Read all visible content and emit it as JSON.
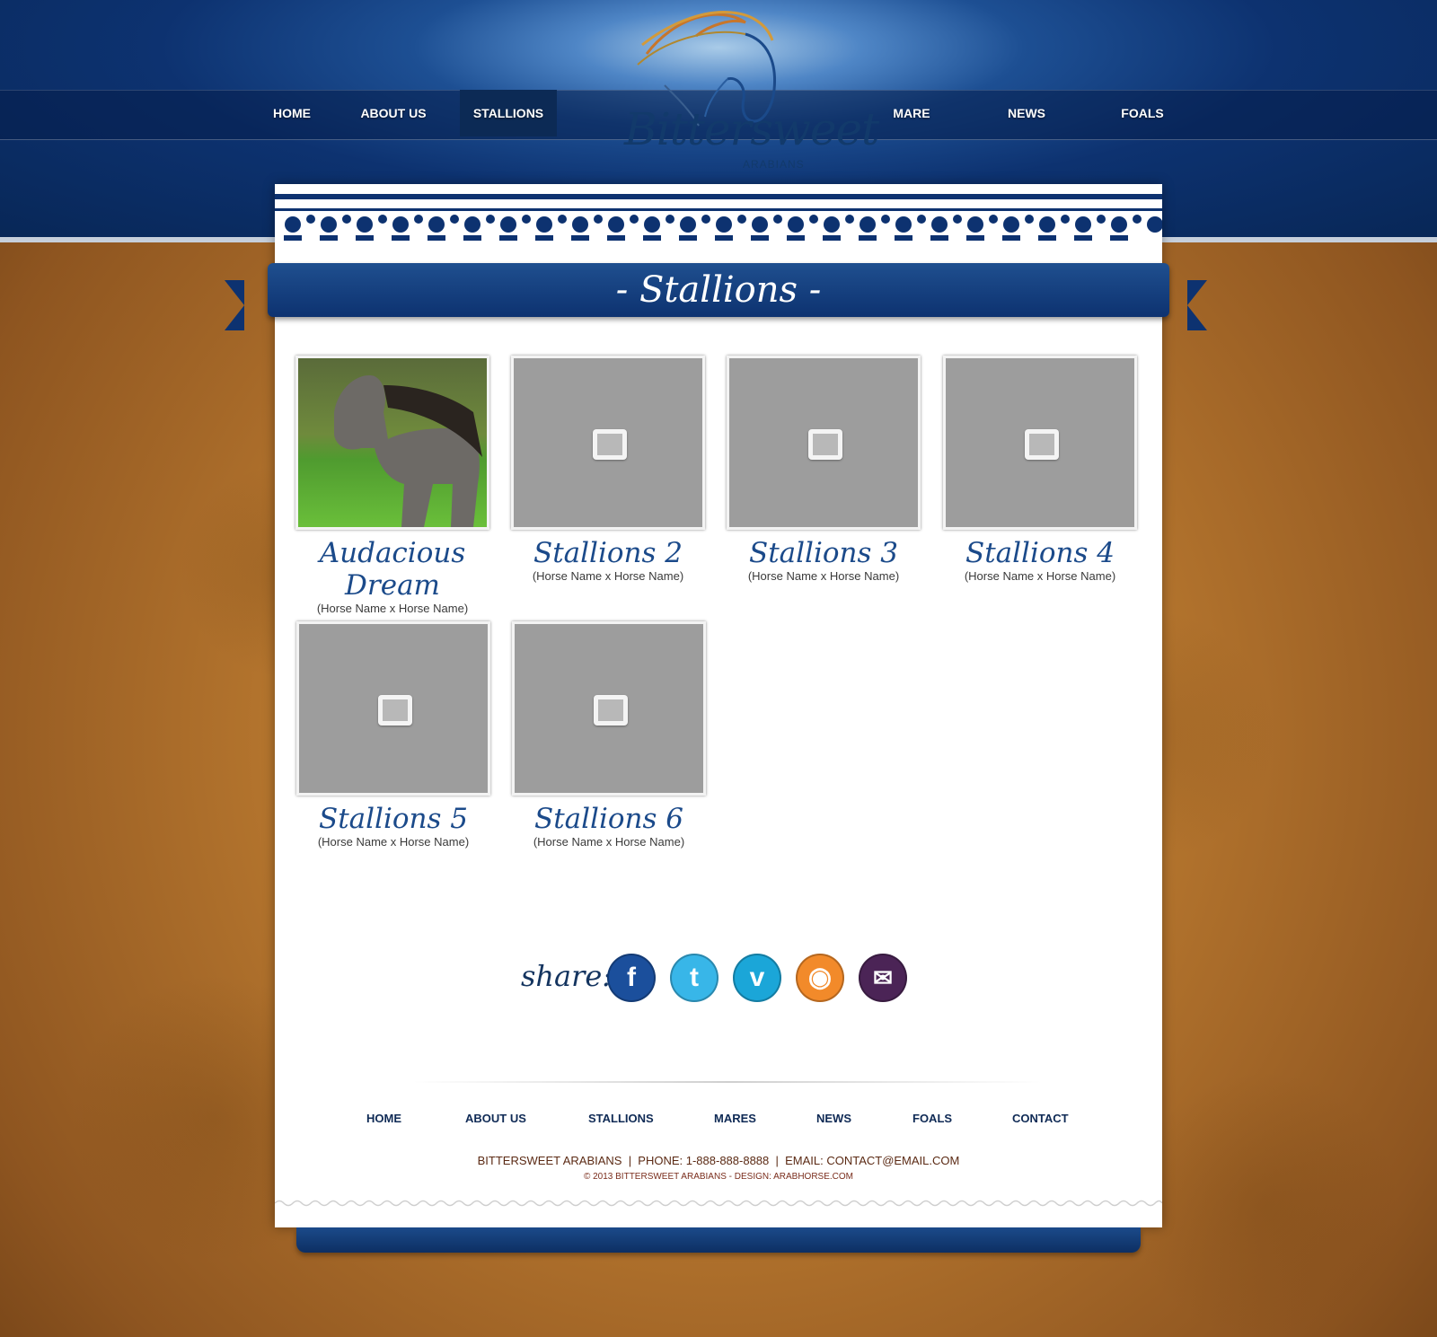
{
  "site": {
    "brand": "Bittersweet",
    "brand_sub": "ARABIANS"
  },
  "nav": {
    "home": "HOME",
    "about": "ABOUT US",
    "stallions": "STALLIONS",
    "mare": "MARE",
    "news": "NEWS",
    "foals": "FOALS"
  },
  "page": {
    "title": "- Stallions -"
  },
  "stallions": [
    {
      "name": "Audacious Dream",
      "lineage": "(Horse Name x Horse Name)",
      "has_photo": true
    },
    {
      "name": "Stallions 2",
      "lineage": "(Horse Name x Horse Name)",
      "has_photo": false
    },
    {
      "name": "Stallions 3",
      "lineage": "(Horse Name x Horse Name)",
      "has_photo": false
    },
    {
      "name": "Stallions 4",
      "lineage": "(Horse Name x Horse Name)",
      "has_photo": false
    },
    {
      "name": "Stallions 5",
      "lineage": "(Horse Name x Horse Name)",
      "has_photo": false
    },
    {
      "name": "Stallions 6",
      "lineage": "(Horse Name x Horse Name)",
      "has_photo": false
    }
  ],
  "share": {
    "label": "share:",
    "networks": [
      {
        "name": "facebook-icon",
        "glyph": "f",
        "color": "#1b4f9c"
      },
      {
        "name": "twitter-icon",
        "glyph": "t",
        "color": "#38b6e8"
      },
      {
        "name": "vimeo-icon",
        "glyph": "v",
        "color": "#1ba6d8"
      },
      {
        "name": "rss-icon",
        "glyph": "◉",
        "color": "#f28a2a"
      },
      {
        "name": "email-icon",
        "glyph": "✉",
        "color": "#4b2456"
      }
    ]
  },
  "footer": {
    "nav": {
      "home": "HOME",
      "about": "ABOUT US",
      "stallions": "STALLIONS",
      "mares": "MARES",
      "news": "NEWS",
      "foals": "FOALS",
      "contact": "CONTACT"
    },
    "contact_line": "BITTERSWEET ARABIANS  |  PHONE: 1-888-888-8888  |  EMAIL: CONTACT@EMAIL.COM",
    "copyright": "© 2013 BITTERSWEET ARABIANS - DESIGN: ARABHORSE.COM"
  },
  "colors": {
    "navy": "#0d3270",
    "accent_blue": "#1b4a8a",
    "leather": "#b8782f"
  }
}
